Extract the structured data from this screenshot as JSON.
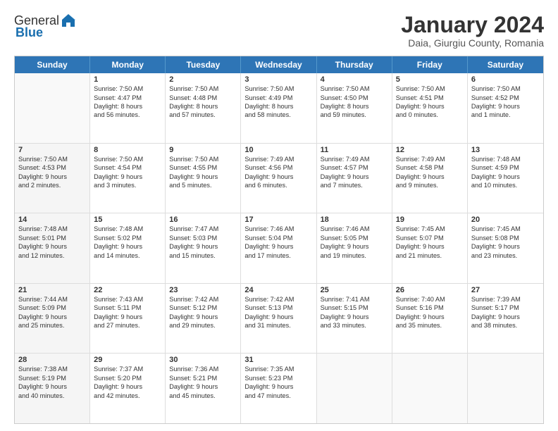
{
  "logo": {
    "general": "General",
    "blue": "Blue"
  },
  "title": "January 2024",
  "subtitle": "Daia, Giurgiu County, Romania",
  "headers": [
    "Sunday",
    "Monday",
    "Tuesday",
    "Wednesday",
    "Thursday",
    "Friday",
    "Saturday"
  ],
  "rows": [
    [
      {
        "day": "",
        "lines": [],
        "empty": true
      },
      {
        "day": "1",
        "lines": [
          "Sunrise: 7:50 AM",
          "Sunset: 4:47 PM",
          "Daylight: 8 hours",
          "and 56 minutes."
        ]
      },
      {
        "day": "2",
        "lines": [
          "Sunrise: 7:50 AM",
          "Sunset: 4:48 PM",
          "Daylight: 8 hours",
          "and 57 minutes."
        ]
      },
      {
        "day": "3",
        "lines": [
          "Sunrise: 7:50 AM",
          "Sunset: 4:49 PM",
          "Daylight: 8 hours",
          "and 58 minutes."
        ]
      },
      {
        "day": "4",
        "lines": [
          "Sunrise: 7:50 AM",
          "Sunset: 4:50 PM",
          "Daylight: 8 hours",
          "and 59 minutes."
        ]
      },
      {
        "day": "5",
        "lines": [
          "Sunrise: 7:50 AM",
          "Sunset: 4:51 PM",
          "Daylight: 9 hours",
          "and 0 minutes."
        ]
      },
      {
        "day": "6",
        "lines": [
          "Sunrise: 7:50 AM",
          "Sunset: 4:52 PM",
          "Daylight: 9 hours",
          "and 1 minute."
        ]
      }
    ],
    [
      {
        "day": "7",
        "lines": [
          "Sunrise: 7:50 AM",
          "Sunset: 4:53 PM",
          "Daylight: 9 hours",
          "and 2 minutes."
        ],
        "shaded": true
      },
      {
        "day": "8",
        "lines": [
          "Sunrise: 7:50 AM",
          "Sunset: 4:54 PM",
          "Daylight: 9 hours",
          "and 3 minutes."
        ]
      },
      {
        "day": "9",
        "lines": [
          "Sunrise: 7:50 AM",
          "Sunset: 4:55 PM",
          "Daylight: 9 hours",
          "and 5 minutes."
        ]
      },
      {
        "day": "10",
        "lines": [
          "Sunrise: 7:49 AM",
          "Sunset: 4:56 PM",
          "Daylight: 9 hours",
          "and 6 minutes."
        ]
      },
      {
        "day": "11",
        "lines": [
          "Sunrise: 7:49 AM",
          "Sunset: 4:57 PM",
          "Daylight: 9 hours",
          "and 7 minutes."
        ]
      },
      {
        "day": "12",
        "lines": [
          "Sunrise: 7:49 AM",
          "Sunset: 4:58 PM",
          "Daylight: 9 hours",
          "and 9 minutes."
        ]
      },
      {
        "day": "13",
        "lines": [
          "Sunrise: 7:48 AM",
          "Sunset: 4:59 PM",
          "Daylight: 9 hours",
          "and 10 minutes."
        ]
      }
    ],
    [
      {
        "day": "14",
        "lines": [
          "Sunrise: 7:48 AM",
          "Sunset: 5:01 PM",
          "Daylight: 9 hours",
          "and 12 minutes."
        ],
        "shaded": true
      },
      {
        "day": "15",
        "lines": [
          "Sunrise: 7:48 AM",
          "Sunset: 5:02 PM",
          "Daylight: 9 hours",
          "and 14 minutes."
        ]
      },
      {
        "day": "16",
        "lines": [
          "Sunrise: 7:47 AM",
          "Sunset: 5:03 PM",
          "Daylight: 9 hours",
          "and 15 minutes."
        ]
      },
      {
        "day": "17",
        "lines": [
          "Sunrise: 7:46 AM",
          "Sunset: 5:04 PM",
          "Daylight: 9 hours",
          "and 17 minutes."
        ]
      },
      {
        "day": "18",
        "lines": [
          "Sunrise: 7:46 AM",
          "Sunset: 5:05 PM",
          "Daylight: 9 hours",
          "and 19 minutes."
        ]
      },
      {
        "day": "19",
        "lines": [
          "Sunrise: 7:45 AM",
          "Sunset: 5:07 PM",
          "Daylight: 9 hours",
          "and 21 minutes."
        ]
      },
      {
        "day": "20",
        "lines": [
          "Sunrise: 7:45 AM",
          "Sunset: 5:08 PM",
          "Daylight: 9 hours",
          "and 23 minutes."
        ]
      }
    ],
    [
      {
        "day": "21",
        "lines": [
          "Sunrise: 7:44 AM",
          "Sunset: 5:09 PM",
          "Daylight: 9 hours",
          "and 25 minutes."
        ],
        "shaded": true
      },
      {
        "day": "22",
        "lines": [
          "Sunrise: 7:43 AM",
          "Sunset: 5:11 PM",
          "Daylight: 9 hours",
          "and 27 minutes."
        ]
      },
      {
        "day": "23",
        "lines": [
          "Sunrise: 7:42 AM",
          "Sunset: 5:12 PM",
          "Daylight: 9 hours",
          "and 29 minutes."
        ]
      },
      {
        "day": "24",
        "lines": [
          "Sunrise: 7:42 AM",
          "Sunset: 5:13 PM",
          "Daylight: 9 hours",
          "and 31 minutes."
        ]
      },
      {
        "day": "25",
        "lines": [
          "Sunrise: 7:41 AM",
          "Sunset: 5:15 PM",
          "Daylight: 9 hours",
          "and 33 minutes."
        ]
      },
      {
        "day": "26",
        "lines": [
          "Sunrise: 7:40 AM",
          "Sunset: 5:16 PM",
          "Daylight: 9 hours",
          "and 35 minutes."
        ]
      },
      {
        "day": "27",
        "lines": [
          "Sunrise: 7:39 AM",
          "Sunset: 5:17 PM",
          "Daylight: 9 hours",
          "and 38 minutes."
        ]
      }
    ],
    [
      {
        "day": "28",
        "lines": [
          "Sunrise: 7:38 AM",
          "Sunset: 5:19 PM",
          "Daylight: 9 hours",
          "and 40 minutes."
        ],
        "shaded": true
      },
      {
        "day": "29",
        "lines": [
          "Sunrise: 7:37 AM",
          "Sunset: 5:20 PM",
          "Daylight: 9 hours",
          "and 42 minutes."
        ]
      },
      {
        "day": "30",
        "lines": [
          "Sunrise: 7:36 AM",
          "Sunset: 5:21 PM",
          "Daylight: 9 hours",
          "and 45 minutes."
        ]
      },
      {
        "day": "31",
        "lines": [
          "Sunrise: 7:35 AM",
          "Sunset: 5:23 PM",
          "Daylight: 9 hours",
          "and 47 minutes."
        ]
      },
      {
        "day": "",
        "lines": [],
        "empty": true
      },
      {
        "day": "",
        "lines": [],
        "empty": true
      },
      {
        "day": "",
        "lines": [],
        "empty": true
      }
    ]
  ]
}
